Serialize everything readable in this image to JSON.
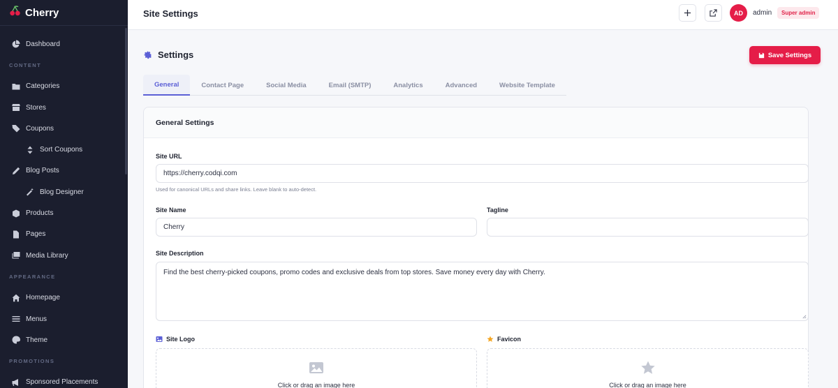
{
  "brand": {
    "name": "Cherry"
  },
  "sidebar": {
    "items": [
      {
        "type": "item",
        "label": "Dashboard",
        "icon": "chart-pie-icon"
      },
      {
        "type": "section",
        "label": "CONTENT"
      },
      {
        "type": "item",
        "label": "Categories",
        "icon": "folder-icon"
      },
      {
        "type": "item",
        "label": "Stores",
        "icon": "store-icon"
      },
      {
        "type": "item",
        "label": "Coupons",
        "icon": "tags-icon"
      },
      {
        "type": "sub",
        "label": "Sort Coupons",
        "icon": "sort-icon"
      },
      {
        "type": "item",
        "label": "Blog Posts",
        "icon": "pen-icon"
      },
      {
        "type": "sub",
        "label": "Blog Designer",
        "icon": "magic-wand-icon"
      },
      {
        "type": "item",
        "label": "Products",
        "icon": "box-icon"
      },
      {
        "type": "item",
        "label": "Pages",
        "icon": "file-icon"
      },
      {
        "type": "item",
        "label": "Media Library",
        "icon": "images-icon"
      },
      {
        "type": "section",
        "label": "APPEARANCE"
      },
      {
        "type": "item",
        "label": "Homepage",
        "icon": "home-icon"
      },
      {
        "type": "item",
        "label": "Menus",
        "icon": "bars-icon"
      },
      {
        "type": "item",
        "label": "Theme",
        "icon": "palette-icon"
      },
      {
        "type": "section",
        "label": "PROMOTIONS"
      },
      {
        "type": "item",
        "label": "Sponsored Placements",
        "icon": "megaphone-icon"
      }
    ]
  },
  "header": {
    "title": "Site Settings",
    "avatar_initials": "AD",
    "username": "admin",
    "role": "Super admin"
  },
  "page": {
    "title": "Settings",
    "save_label": "Save Settings",
    "tabs": [
      "General",
      "Contact Page",
      "Social Media",
      "Email (SMTP)",
      "Analytics",
      "Advanced",
      "Website Template"
    ],
    "active_tab": "General"
  },
  "form": {
    "card_title": "General Settings",
    "site_url": {
      "label": "Site URL",
      "value": "https://cherry.codqi.com",
      "hint": "Used for canonical URLs and share links. Leave blank to auto-detect."
    },
    "site_name": {
      "label": "Site Name",
      "value": "Cherry"
    },
    "tagline": {
      "label": "Tagline",
      "value": ""
    },
    "site_description": {
      "label": "Site Description",
      "value": "Find the best cherry-picked coupons, promo codes and exclusive deals from top stores. Save money every day with Cherry."
    },
    "site_logo": {
      "label": "Site Logo",
      "dropzone_text": "Click or drag an image here"
    },
    "favicon": {
      "label": "Favicon",
      "dropzone_text": "Click or drag an image here"
    }
  },
  "colors": {
    "accent": "#e51d48",
    "primary": "#5b5fd6",
    "sidebar_bg": "#1b1e2e",
    "favicon_star": "#f5a623"
  }
}
